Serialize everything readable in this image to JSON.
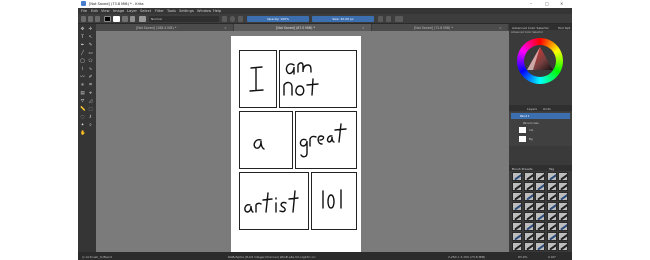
{
  "window": {
    "title": "[Not Saved] (73.8 MiB) * - Krita",
    "controls": [
      "–",
      "□",
      "×"
    ]
  },
  "menu": [
    "File",
    "Edit",
    "View",
    "Image",
    "Layer",
    "Select",
    "Filter",
    "Tools",
    "Settings",
    "Window",
    "Help"
  ],
  "toolbar": {
    "brush_preset": "Ink Layout",
    "blend_mode": "Normal",
    "opacity": "Opacity: 100%",
    "size": "Size: 30.00 px"
  },
  "tabs": [
    {
      "label": "[Not Saved] (288.4 KiB) *"
    },
    {
      "label": "[Not Saved] (67.0 MiB) *"
    },
    {
      "label": "[Not Saved] (72.8 MiB) *"
    }
  ],
  "comic": {
    "panel_texts": [
      "I",
      "am not",
      "a",
      "great",
      "artist",
      "lol"
    ]
  },
  "dockers": {
    "color_selector_title": "Advanced Color Selector",
    "color_selector_tab": "Tool Opt",
    "color_selector_sub": "Advanced Color Selector",
    "layers_title": "Layers",
    "layers_tab": "Undo",
    "layers": [
      {
        "name": "Paint 1",
        "active": true
      },
      {
        "name": "Panel Lines",
        "active": false
      },
      {
        "name": "Ink",
        "active": false
      },
      {
        "name": "Bg",
        "active": false
      }
    ],
    "brush_presets_title": "Brush Presets",
    "tag_label": "Tag"
  },
  "statusbar": {
    "left": "◎ Airbrush_hi Blend",
    "center": "RGB/Alpha (8-bit integer/channel)  sRGB-elle-V2-srgbtrc.icc",
    "right_size": "2,250 x 3,150 (73.8 MiB)",
    "zoom": "83.9%",
    "rotation": "0.00°"
  },
  "colors": {
    "canvas_bg": "#7b7b7b",
    "ui_dark": "#3a3a3a",
    "accent": "#3c6fb0"
  }
}
